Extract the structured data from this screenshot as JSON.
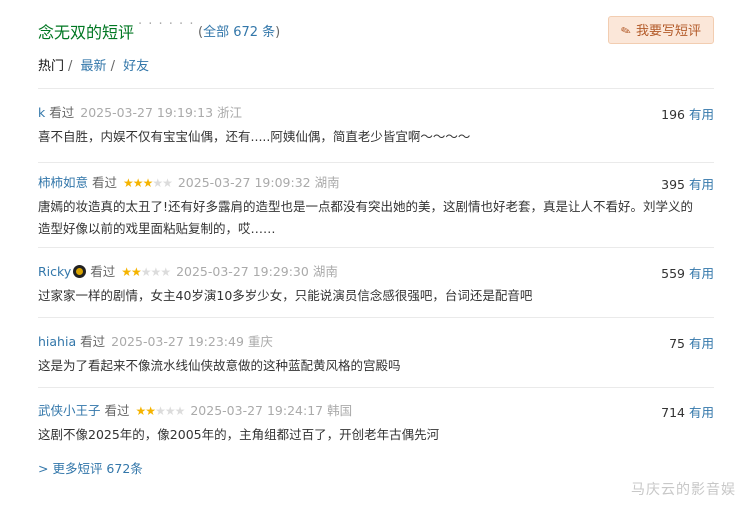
{
  "header": {
    "title": "念无双的短评",
    "dots": "· · · · · ·",
    "count_prefix": "(",
    "count_link": "全部 672 条",
    "count_suffix": ")",
    "write_button": "我要写短评"
  },
  "tabs": [
    {
      "label": "热门",
      "active": true
    },
    {
      "label": "最新",
      "active": false
    },
    {
      "label": "好友",
      "active": false
    }
  ],
  "reviews": [
    {
      "user": "k",
      "watched": "看过",
      "rating": 0,
      "rating_max": 5,
      "time": "2025-03-27 19:19:13",
      "location": "浙江",
      "votes": "196",
      "useful": "有用",
      "content": "喜不自胜，内娱不仅有宝宝仙偶，还有.....阿姨仙偶，简直老少皆宜啊～～～～"
    },
    {
      "user": "柿柿如意",
      "watched": "看过",
      "rating": 3,
      "rating_max": 5,
      "time": "2025-03-27 19:09:32",
      "location": "湖南",
      "votes": "395",
      "useful": "有用",
      "content": "唐嫣的妆造真的太丑了!还有好多露肩的造型也是一点都没有突出她的美，这剧情也好老套，真是让人不看好。刘学义的造型好像以前的戏里面粘贴复制的，哎……"
    },
    {
      "user": "Ricky",
      "watched": "看过",
      "rating": 2,
      "rating_max": 5,
      "time": "2025-03-27 19:29:30",
      "location": "湖南",
      "votes": "559",
      "useful": "有用",
      "content": "过家家一样的剧情，女主40岁演10多岁少女，只能说演员信念感很强吧，台词还是配音吧"
    },
    {
      "user": "hiahia",
      "watched": "看过",
      "rating": 0,
      "rating_max": 5,
      "time": "2025-03-27 19:23:49",
      "location": "重庆",
      "votes": "75",
      "useful": "有用",
      "content": "这是为了看起来不像流水线仙侠故意做的这种蓝配黄风格的宫殿吗"
    },
    {
      "user": "武侠小王子",
      "watched": "看过",
      "rating": 2,
      "rating_max": 5,
      "time": "2025-03-27 19:24:17",
      "location": "韩国",
      "votes": "714",
      "useful": "有用",
      "content": "这剧不像2025年的，像2005年的，主角组都过百了，开创老年古偶先河"
    }
  ],
  "more_link": "> 更多短评 672条",
  "watermark": "马庆云的影音娱",
  "colors": {
    "title": "#007722",
    "link": "#3377aa",
    "star": "#f5b400",
    "button_bg": "#fbe7d9"
  }
}
